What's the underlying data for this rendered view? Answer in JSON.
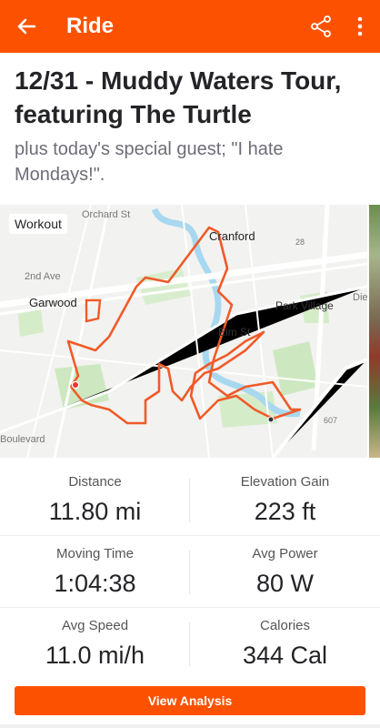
{
  "app_bar": {
    "title": "Ride",
    "back_icon": "arrow-left-icon",
    "share_icon": "share-icon",
    "more_icon": "more-vertical-icon",
    "background": "#fc5200"
  },
  "activity": {
    "title": "12/31 - Muddy Waters Tour, featuring The Turtle",
    "description": "plus today's special guest; \"I hate Mondays!\"."
  },
  "map": {
    "badge": "Workout",
    "labels": {
      "cranford": "Cranford",
      "garwood": "Garwood",
      "park_village": "Park Village",
      "elm_st": "Elm St",
      "second_ave": "2nd Ave",
      "orchard_st": "Orchard St",
      "boulevard": "Boulevard",
      "route_28": "28",
      "route_607": "607",
      "die": "Die"
    },
    "route_color": "#f05a28"
  },
  "stats": [
    {
      "left": {
        "label": "Distance",
        "value": "11.80 mi"
      },
      "right": {
        "label": "Elevation Gain",
        "value": "223 ft"
      }
    },
    {
      "left": {
        "label": "Moving Time",
        "value": "1:04:38"
      },
      "right": {
        "label": "Avg Power",
        "value": "80 W"
      }
    },
    {
      "left": {
        "label": "Avg Speed",
        "value": "11.0 mi/h"
      },
      "right": {
        "label": "Calories",
        "value": "344 Cal"
      }
    }
  ],
  "actions": {
    "view_analysis": "View Analysis"
  }
}
